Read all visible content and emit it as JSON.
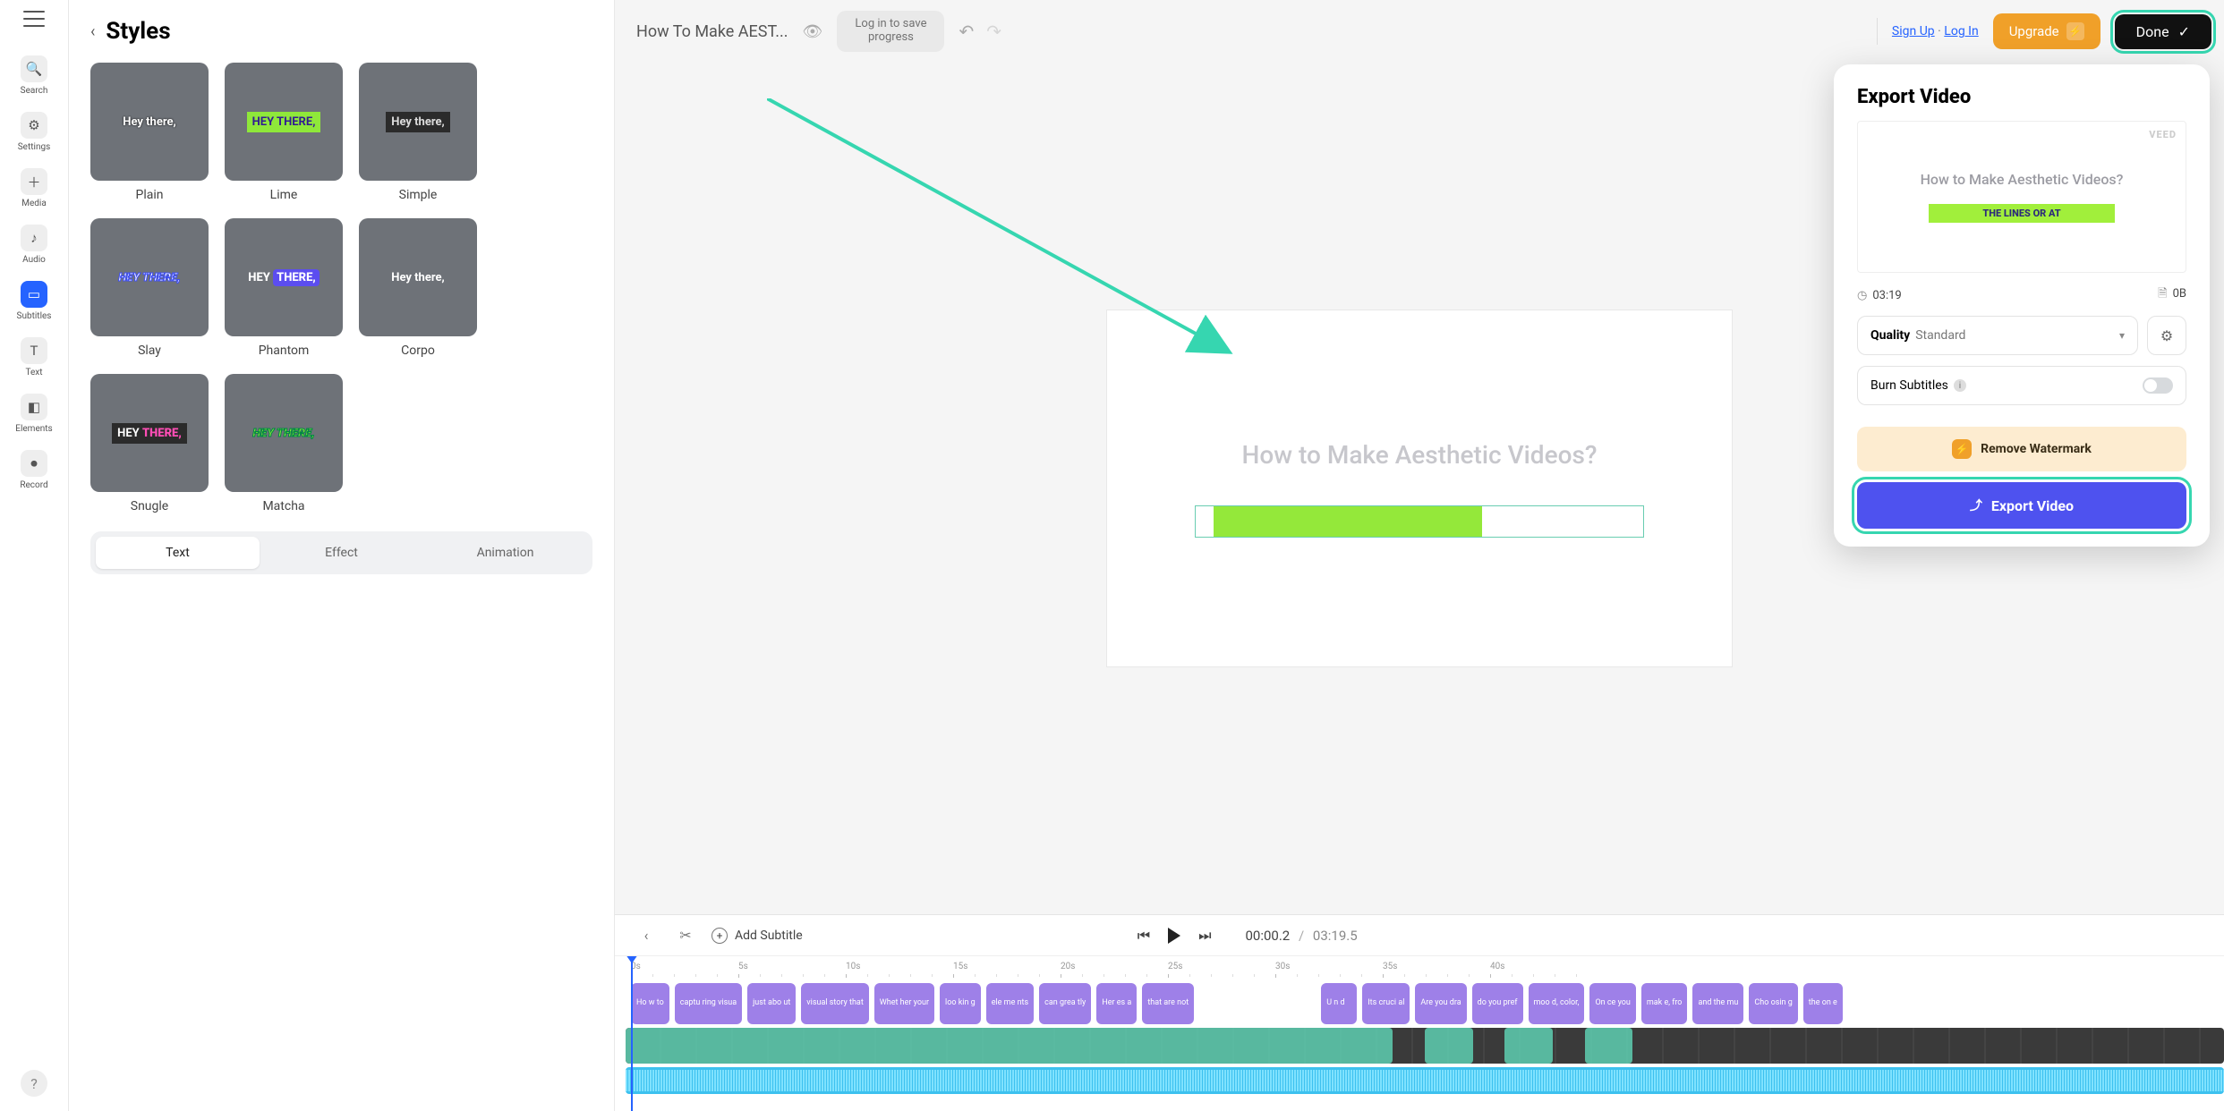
{
  "rail": {
    "items": [
      {
        "label": "Search",
        "icon": "🔍"
      },
      {
        "label": "Settings",
        "icon": "⚙"
      },
      {
        "label": "Media",
        "icon": "＋"
      },
      {
        "label": "Audio",
        "icon": "♪"
      },
      {
        "label": "Subtitles",
        "icon": "▭"
      },
      {
        "label": "Text",
        "icon": "T"
      },
      {
        "label": "Elements",
        "icon": "◧"
      },
      {
        "label": "Record",
        "icon": "⏺"
      }
    ],
    "help": "?"
  },
  "panel": {
    "title": "Styles",
    "styles": [
      {
        "name": "Plain",
        "sample": "Hey there,"
      },
      {
        "name": "Lime",
        "sample": "HEY THERE,"
      },
      {
        "name": "Simple",
        "sample": "Hey there,"
      },
      {
        "name": "Slay",
        "sample": "HEY THERE,"
      },
      {
        "name": "Phantom",
        "sample_a": "HEY ",
        "sample_b": "THERE,"
      },
      {
        "name": "Corpo",
        "sample": "Hey there,"
      },
      {
        "name": "Snugle",
        "sample_a": "HEY ",
        "sample_b": "THERE,"
      },
      {
        "name": "Matcha",
        "sample": "HEY THERE,"
      }
    ],
    "tabs": [
      "Text",
      "Effect",
      "Animation"
    ]
  },
  "topbar": {
    "title": "How To Make AEST...",
    "login_line1": "Log in to save",
    "login_line2": "progress",
    "signup": "Sign Up",
    "dot": "·",
    "login": "Log In",
    "upgrade": "Upgrade",
    "done": "Done"
  },
  "canvas": {
    "heading": "How to Make Aesthetic Videos?"
  },
  "timeline": {
    "add_subtitle": "Add Subtitle",
    "current": "00:00.2",
    "slash": "/",
    "duration": "03:19.5",
    "ticks": [
      "0s",
      "5s",
      "10s",
      "15s",
      "20s",
      "25s",
      "30s",
      "35s",
      "40s"
    ],
    "subs": [
      "Ho w to",
      "captu ring visua",
      "just abo ut",
      "visual story that",
      "Whet her your",
      "loo kin g",
      "ele me nts",
      "can grea tly",
      "Her es a",
      "that are not",
      "U n d",
      "Its cruci al",
      "Are you dra",
      "do you pref",
      "moo d, color,",
      "On ce you",
      "mak e, fro",
      "and the mu",
      "Cho osin g",
      "the on e"
    ]
  },
  "popover": {
    "title": "Export Video",
    "brand": "VEED",
    "preview_title": "How to Make Aesthetic Videos?",
    "preview_highlight": "THE LINES OR AT",
    "duration": "03:19",
    "size": "0B",
    "quality_label": "Quality",
    "quality_value": "Standard",
    "burn_label": "Burn Subtitles",
    "remove_label": "Remove Watermark",
    "export_label": "Export Video"
  }
}
